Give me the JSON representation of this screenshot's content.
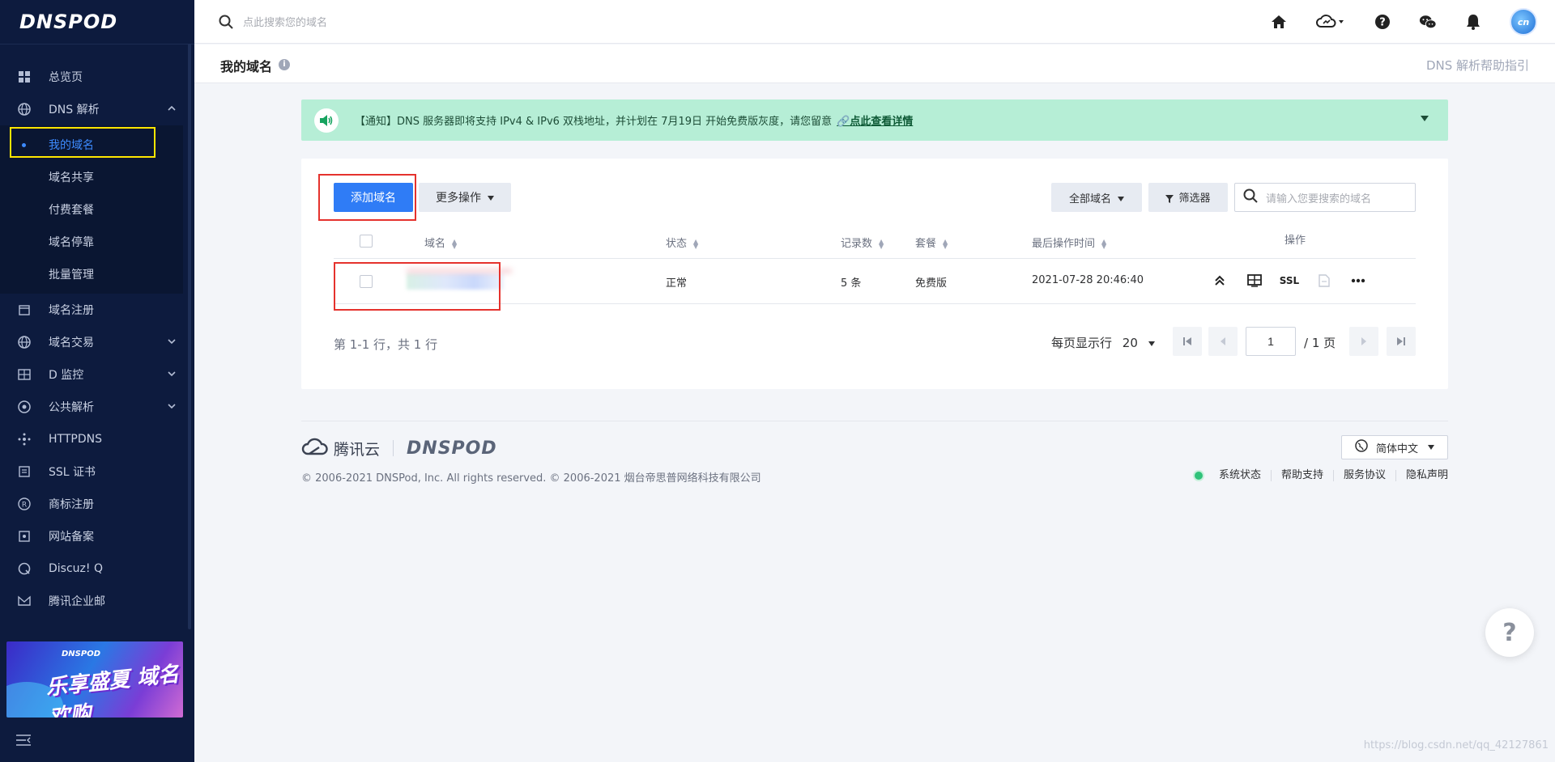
{
  "brand": {
    "logo_text": "DNSPOD"
  },
  "sidebar": {
    "items": [
      {
        "label": "总览页",
        "icon": "dashboard-icon"
      },
      {
        "label": "DNS 解析",
        "icon": "globe-icon",
        "expanded": true
      }
    ],
    "dns_submenu": [
      {
        "label": "我的域名",
        "active": true
      },
      {
        "label": "域名共享"
      },
      {
        "label": "付费套餐"
      },
      {
        "label": "域名停靠"
      },
      {
        "label": "批量管理"
      }
    ],
    "more_items": [
      {
        "label": "域名注册",
        "icon": "calendar-icon"
      },
      {
        "label": "域名交易",
        "icon": "globe-icon"
      },
      {
        "label": "D 监控",
        "icon": "monitor-icon"
      },
      {
        "label": "公共解析",
        "icon": "public-dns-icon"
      },
      {
        "label": "HTTPDNS",
        "icon": "nodes-icon"
      },
      {
        "label": "SSL 证书",
        "icon": "certificate-icon"
      },
      {
        "label": "商标注册",
        "icon": "registered-icon"
      },
      {
        "label": "网站备案",
        "icon": "record-icon"
      },
      {
        "label": "Discuz! Q",
        "icon": "discuz-icon"
      },
      {
        "label": "腾讯企业邮",
        "icon": "mail-icon"
      }
    ],
    "banner": {
      "small": "DNSPOD",
      "big": "乐享盛夏 域名欢购"
    }
  },
  "topbar": {
    "search_placeholder": "点此搜索您的域名",
    "avatar_text": "cn"
  },
  "page": {
    "title": "我的域名",
    "help_link": "DNS 解析帮助指引"
  },
  "notice": {
    "text": "【通知】DNS 服务器即将支持 IPv4 & IPv6 双栈地址，并计划在 7月19日 开始免费版灰度，请您留意",
    "link": "点此查看详情"
  },
  "toolbar": {
    "add_domain": "添加域名",
    "more_actions": "更多操作",
    "all_domains": "全部域名",
    "filter": "筛选器",
    "search_placeholder": "请输入您要搜索的域名"
  },
  "table": {
    "headers": {
      "domain": "域名",
      "status": "状态",
      "records": "记录数",
      "plan": "套餐",
      "last_op": "最后操作时间",
      "actions": "操作"
    },
    "rows": [
      {
        "domain": "",
        "status": "正常",
        "records": "5 条",
        "plan": "免费版",
        "last_op": "2021-07-28 20:46:40",
        "ssl": "SSL"
      }
    ]
  },
  "pagination": {
    "summary": "第 1-1 行，共 1 行",
    "per_page_label": "每页显示行",
    "per_page_value": "20",
    "current_page": "1",
    "total_pages": "/ 1 页"
  },
  "footer": {
    "tencent_cloud": "腾讯云",
    "dnspod": "DNSPOD",
    "copyright": "© 2006-2021 DNSPod, Inc. All rights reserved. © 2006-2021 烟台帝思普网络科技有限公司",
    "language": "简体中文",
    "links": [
      "系统状态",
      "帮助支持",
      "服务协议",
      "隐私声明"
    ]
  },
  "watermark": "https://blog.csdn.net/qq_42127861",
  "colors": {
    "sidebar_bg": "#0d1b3e",
    "primary": "#2f7cf6",
    "notice_bg": "#b6eed6",
    "highlight_yellow": "#ffe600",
    "highlight_red": "#e5322d"
  }
}
